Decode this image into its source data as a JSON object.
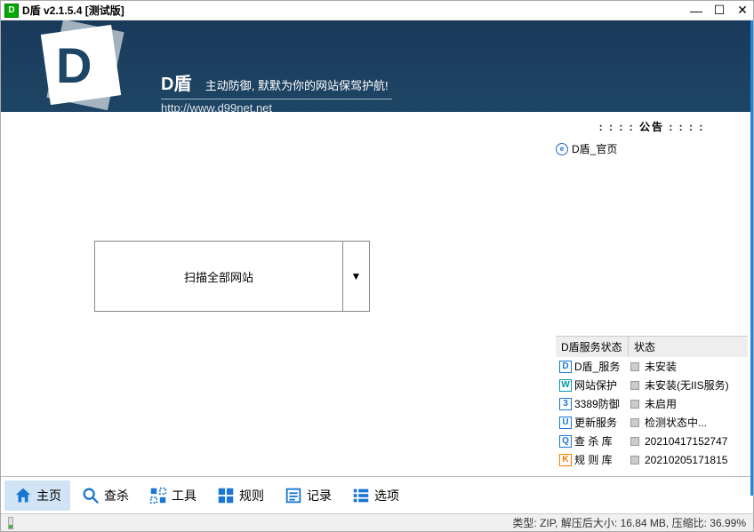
{
  "titlebar": {
    "title": "D盾 v2.1.5.4 [测试版]"
  },
  "banner": {
    "brand": "D盾",
    "slogan": "主动防御, 默默为你的网站保驾护航!",
    "url": "http://www.d99net.net"
  },
  "main": {
    "scan_button": "扫描全部网站"
  },
  "side": {
    "announce_title": ": : : :  公告  : : : :",
    "announce_items": [
      "D盾_官页"
    ],
    "status_headers": {
      "col1": "D盾服务状态",
      "col2": "状态"
    },
    "status_rows": [
      {
        "icon": "D",
        "cls": "ic-blue",
        "name": "D盾_服务",
        "status": "未安装"
      },
      {
        "icon": "W",
        "cls": "ic-cyan",
        "name": "网站保护",
        "status": "未安装(无IIS服务)"
      },
      {
        "icon": "3",
        "cls": "ic-blue",
        "name": "3389防御",
        "status": "未启用"
      },
      {
        "icon": "U",
        "cls": "ic-blue",
        "name": "更新服务",
        "status": "检测状态中..."
      },
      {
        "icon": "Q",
        "cls": "ic-blue",
        "name": "查 杀 库",
        "status": "20210417152747"
      },
      {
        "icon": "K",
        "cls": "ic-orange",
        "name": "规 则 库",
        "status": "20210205171815"
      }
    ]
  },
  "toolbar": {
    "items": [
      {
        "label": "主页",
        "icon": "home",
        "active": true
      },
      {
        "label": "查杀",
        "icon": "search",
        "active": false
      },
      {
        "label": "工具",
        "icon": "tools",
        "active": false
      },
      {
        "label": "规则",
        "icon": "grid",
        "active": false
      },
      {
        "label": "记录",
        "icon": "list",
        "active": false
      },
      {
        "label": "选项",
        "icon": "options",
        "active": false
      }
    ]
  },
  "statusbar": {
    "type_label": "类型:",
    "type_value": "ZIP,",
    "size_label": "解压后大小:",
    "size_value": "16.84 MB,",
    "ratio_label": "压缩比:",
    "ratio_value": "36.99%"
  }
}
